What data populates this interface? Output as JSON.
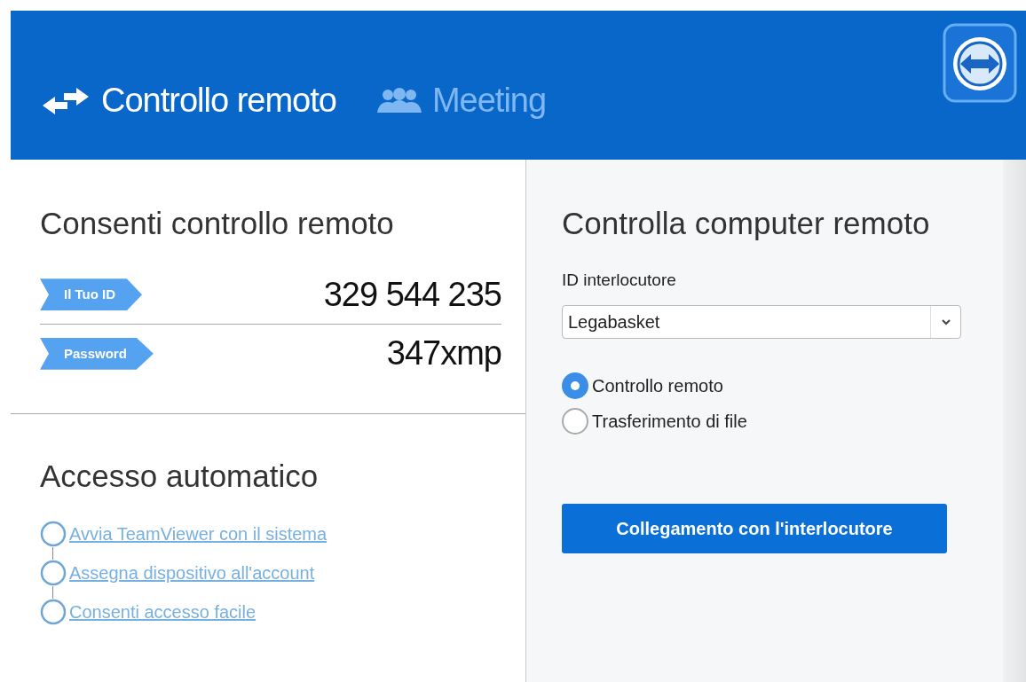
{
  "tabs": [
    {
      "label": "Controllo remoto",
      "selected": true,
      "kind": "arrows"
    },
    {
      "label": "Meeting",
      "selected": false,
      "kind": "people"
    }
  ],
  "allow_panel": {
    "title": "Consenti controllo remoto",
    "fields": [
      {
        "label": "Il Tuo ID",
        "value": "329 544 235"
      },
      {
        "label": "Password",
        "value": "347xmp"
      }
    ]
  },
  "auto_access": {
    "title": "Accesso automatico",
    "links": [
      "Avvia TeamViewer con il sistema",
      "Assegna dispositivo all'account",
      "Consenti accesso facile"
    ]
  },
  "control_panel": {
    "title": "Controlla computer remoto",
    "partner_label": "ID interlocutore",
    "partner_value": "Legabasket",
    "options": [
      {
        "label": "Controllo remoto",
        "selected": true
      },
      {
        "label": "Trasferimento di file",
        "selected": false
      }
    ],
    "connect_button": "Collegamento con l'interlocutore"
  }
}
